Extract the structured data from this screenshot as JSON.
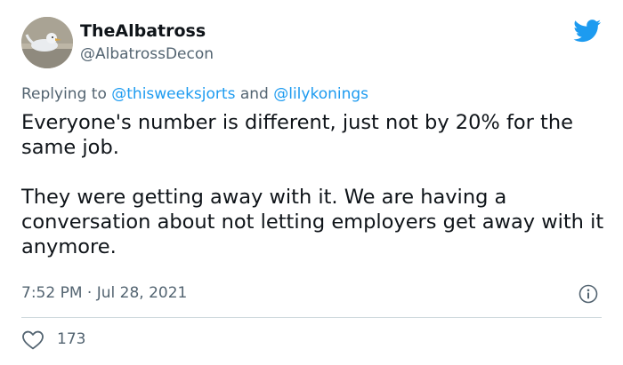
{
  "author": {
    "name": "TheAlbatross",
    "handle": "@AlbatrossDecon"
  },
  "reply": {
    "prefix": "Replying to",
    "mention_1": "@thisweeksjorts",
    "conjunction": "and",
    "mention_2": "@lilykonings"
  },
  "tweet": {
    "paragraph_1": "Everyone's number is different, just not by 20% for the same job.",
    "paragraph_2": "They were getting away with it. We are having a conversation about not letting employers get away with it anymore."
  },
  "meta": {
    "timestamp": "7:52 PM · Jul 28, 2021"
  },
  "engagement": {
    "likes": "173"
  },
  "colors": {
    "accent": "#1d9bf0",
    "text": "#0f1419",
    "secondary_text": "#536471",
    "divider": "#cfd9de"
  },
  "icons": [
    "twitter-bird-icon",
    "info-icon",
    "heart-icon"
  ]
}
